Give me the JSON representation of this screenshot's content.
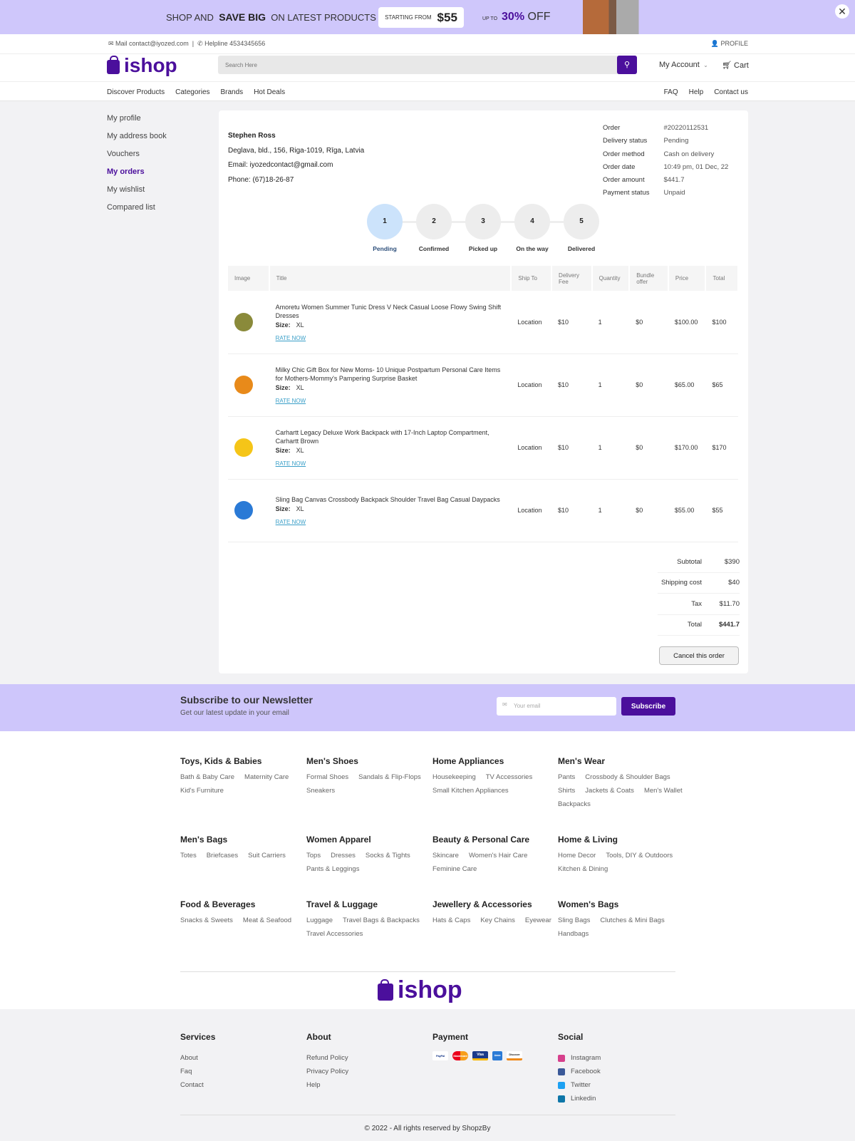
{
  "banner": {
    "text_pre": "SHOP AND",
    "text_bold": "SAVE BIG",
    "text_post": "ON LATEST PRODUCTS",
    "starting_label": "STARTING FROM",
    "starting_price": "$55",
    "upto": "UP TO",
    "discount": "30%",
    "off": "OFF",
    "close": "✕"
  },
  "topbar": {
    "mail": "Mail contact@iyozed.com",
    "separator": "|",
    "helpline": "Helpline 4534345656",
    "profile": "PROFILE"
  },
  "header": {
    "logo": "ishop",
    "search_placeholder": "Search Here",
    "my_account": "My Account",
    "cart": "Cart"
  },
  "nav": {
    "left": [
      "Discover Products",
      "Categories",
      "Brands",
      "Hot Deals"
    ],
    "right": [
      "FAQ",
      "Help",
      "Contact us"
    ]
  },
  "sidebar": [
    "My profile",
    "My address book",
    "Vouchers",
    "My orders",
    "My wishlist",
    "Compared list"
  ],
  "customer": {
    "name": "Stephen Ross",
    "address": "Deglava, bld., 156, Riga-1019, Rīga, Latvia",
    "email": "Email: iyozedcontact@gmail.com",
    "phone": "Phone: (67)18-26-87"
  },
  "order_meta": [
    [
      "Order",
      "#20220112531"
    ],
    [
      "Delivery status",
      "Pending"
    ],
    [
      "Order method",
      "Cash on delivery"
    ],
    [
      "Order date",
      "10:49 pm, 01 Dec, 22"
    ],
    [
      "Order amount",
      "$441.7"
    ],
    [
      "Payment status",
      "Unpaid"
    ]
  ],
  "steps": [
    {
      "n": "1",
      "label": "Pending"
    },
    {
      "n": "2",
      "label": "Confirmed"
    },
    {
      "n": "3",
      "label": "Picked up"
    },
    {
      "n": "4",
      "label": "On the way"
    },
    {
      "n": "5",
      "label": "Delivered"
    }
  ],
  "table": {
    "headers": [
      "Image",
      "Title",
      "Ship To",
      "Delivery Fee",
      "Quantity",
      "Bundle offer",
      "Price",
      "Total"
    ],
    "size_label": "Size:",
    "rate_label": "RATE NOW",
    "rows": [
      {
        "title": "Amoretu Women Summer Tunic Dress V Neck Casual Loose Flowy Swing Shift Dresses",
        "size": "XL",
        "ship": "Location",
        "fee": "$10",
        "qty": "1",
        "bundle": "$0",
        "price": "$100.00",
        "total": "$100",
        "color": "#8a8a3a"
      },
      {
        "title": "Milky Chic Gift Box for New Moms- 10 Unique Postpartum Personal Care Items for Mothers-Mommy's Pampering Surprise Basket",
        "size": "XL",
        "ship": "Location",
        "fee": "$10",
        "qty": "1",
        "bundle": "$0",
        "price": "$65.00",
        "total": "$65",
        "color": "#e88a1a"
      },
      {
        "title": "Carhartt Legacy Deluxe Work Backpack with 17-Inch Laptop Compartment, Carhartt Brown",
        "size": "XL",
        "ship": "Location",
        "fee": "$10",
        "qty": "1",
        "bundle": "$0",
        "price": "$170.00",
        "total": "$170",
        "color": "#f5c518"
      },
      {
        "title": "Sling Bag Canvas Crossbody Backpack Shoulder Travel Bag Casual Daypacks",
        "size": "XL",
        "ship": "Location",
        "fee": "$10",
        "qty": "1",
        "bundle": "$0",
        "price": "$55.00",
        "total": "$55",
        "color": "#2a7ad6"
      }
    ]
  },
  "totals": [
    [
      "Subtotal",
      "$390"
    ],
    [
      "Shipping cost",
      "$40"
    ],
    [
      "Tax",
      "$11.70"
    ],
    [
      "Total",
      "$441.7"
    ]
  ],
  "cancel": "Cancel this order",
  "newsletter": {
    "title": "Subscribe to our Newsletter",
    "subtitle": "Get our latest update in your email",
    "placeholder": "Your email",
    "button": "Subscribe"
  },
  "categories": [
    {
      "title": "Toys, Kids & Babies",
      "links": [
        "Bath & Baby Care",
        "Maternity Care",
        "Kid's Furniture"
      ]
    },
    {
      "title": "Men's Shoes",
      "links": [
        "Formal Shoes",
        "Sandals & Flip-Flops",
        "Sneakers"
      ]
    },
    {
      "title": "Home Appliances",
      "links": [
        "Housekeeping",
        "TV Accessories",
        "Small Kitchen Appliances"
      ]
    },
    {
      "title": "Men's Wear",
      "links": [
        "Pants",
        "Crossbody & Shoulder Bags",
        "Shirts",
        "Jackets & Coats",
        "Men's Wallet",
        "Backpacks"
      ]
    },
    {
      "title": "Men's Bags",
      "links": [
        "Totes",
        "Briefcases",
        "Suit Carriers"
      ]
    },
    {
      "title": "Women Apparel",
      "links": [
        "Tops",
        "Dresses",
        "Socks & Tights",
        "Pants & Leggings"
      ]
    },
    {
      "title": "Beauty & Personal Care",
      "links": [
        "Skincare",
        "Women's Hair Care",
        "Feminine Care"
      ]
    },
    {
      "title": "Home & Living",
      "links": [
        "Home Decor",
        "Tools, DIY & Outdoors",
        "Kitchen & Dining"
      ]
    },
    {
      "title": "Food & Beverages",
      "links": [
        "Snacks & Sweets",
        "Meat & Seafood"
      ]
    },
    {
      "title": "Travel & Luggage",
      "links": [
        "Luggage",
        "Travel Bags & Backpacks",
        "Travel Accessories"
      ]
    },
    {
      "title": "Jewellery & Accessories",
      "links": [
        "Hats & Caps",
        "Key Chains",
        "Eyewear"
      ]
    },
    {
      "title": "Women's Bags",
      "links": [
        "Sling Bags",
        "Clutches & Mini Bags",
        "Handbags"
      ]
    }
  ],
  "footer": {
    "services": {
      "title": "Services",
      "links": [
        "About",
        "Faq",
        "Contact"
      ]
    },
    "about": {
      "title": "About",
      "links": [
        "Refund Policy",
        "Privacy Policy",
        "Help"
      ]
    },
    "payment": {
      "title": "Payment",
      "methods": [
        "PayPal",
        "Mastercard",
        "Visa",
        "Amex",
        "Discover"
      ]
    },
    "social": {
      "title": "Social",
      "links": [
        {
          "label": "Instagram",
          "color": "#d6408c"
        },
        {
          "label": "Facebook",
          "color": "#3b5998"
        },
        {
          "label": "Twitter",
          "color": "#1da1f2"
        },
        {
          "label": "Linkedin",
          "color": "#0e76a8"
        }
      ]
    },
    "copyright": "© 2022 - All rights reserved by ShopzBy"
  },
  "colors": {
    "brand": "#4b0f9c",
    "banner": "#cfc7fb"
  }
}
